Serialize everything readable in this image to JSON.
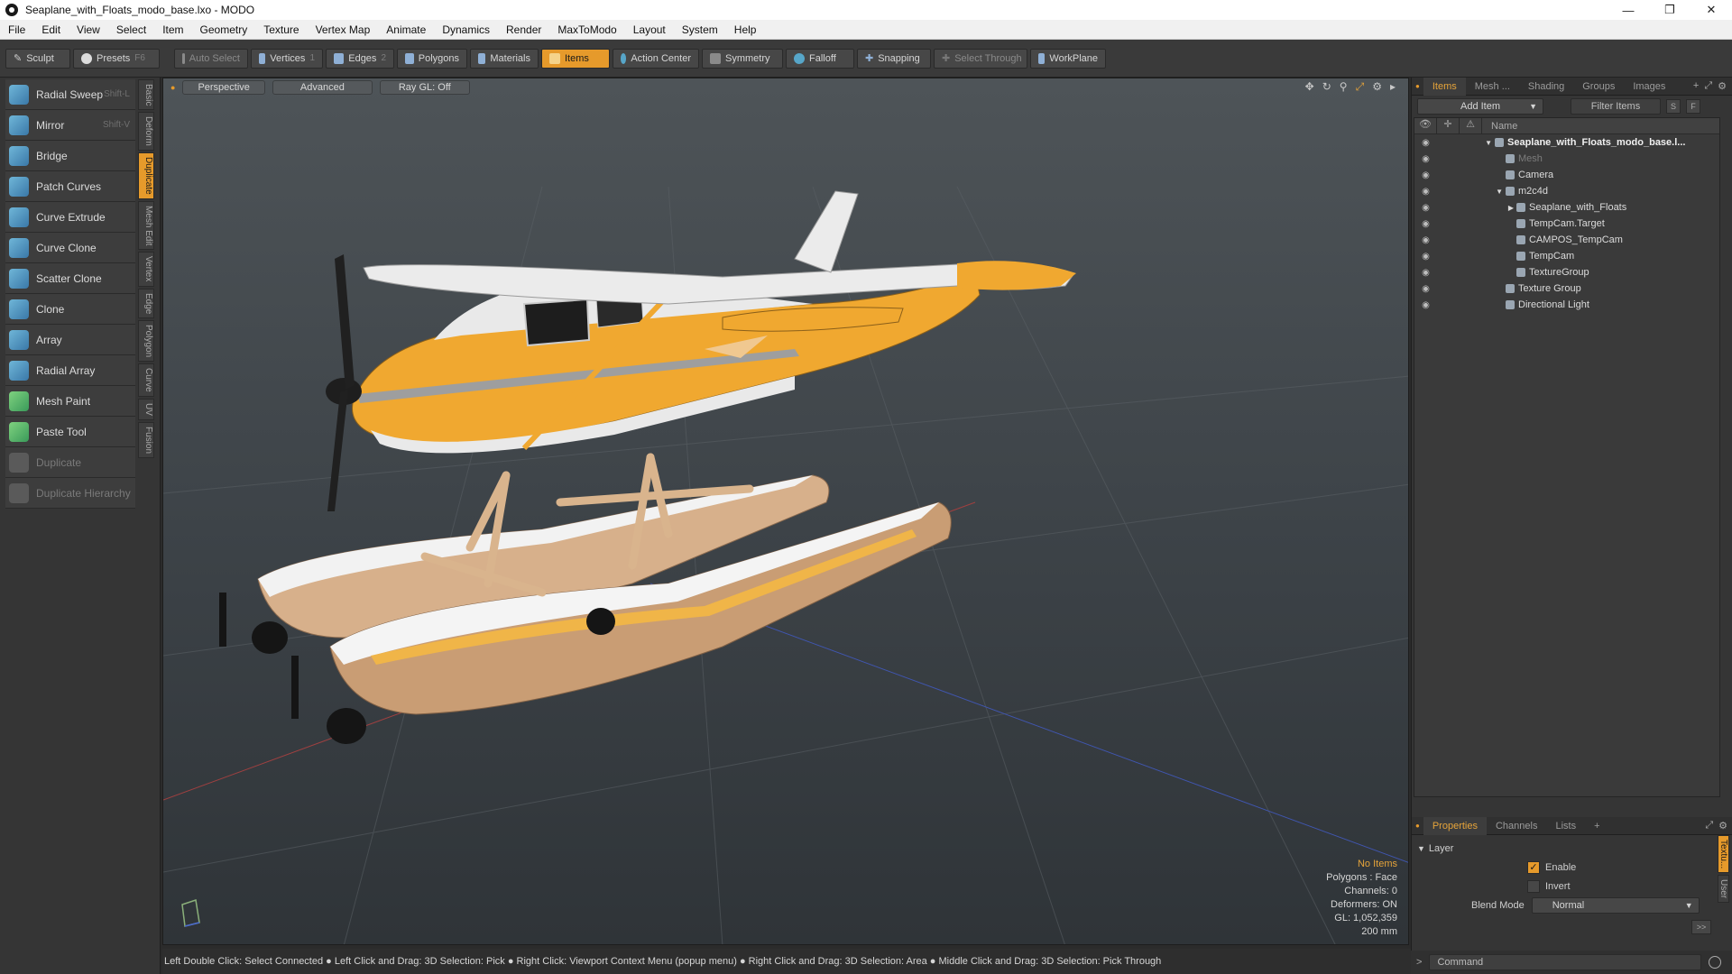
{
  "window": {
    "title": "Seaplane_with_Floats_modo_base.lxo - MODO",
    "controls": [
      "—",
      "❐",
      "✕"
    ]
  },
  "menu": [
    "File",
    "Edit",
    "View",
    "Select",
    "Item",
    "Geometry",
    "Texture",
    "Vertex Map",
    "Animate",
    "Dynamics",
    "Render",
    "MaxToModo",
    "Layout",
    "System",
    "Help"
  ],
  "toolbar": {
    "sculpt": "Sculpt",
    "presets": "Presets",
    "presets_key": "F6",
    "auto_select": "Auto Select",
    "vertices": "Vertices",
    "vertices_key": "1",
    "edges": "Edges",
    "edges_key": "2",
    "polygons": "Polygons",
    "materials": "Materials",
    "items": "Items",
    "action_center": "Action Center",
    "symmetry": "Symmetry",
    "falloff": "Falloff",
    "snapping": "Snapping",
    "select_through": "Select Through",
    "workplane": "WorkPlane"
  },
  "tools": [
    {
      "label": "Radial Sweep",
      "key": "Shift-L"
    },
    {
      "label": "Mirror",
      "key": "Shift-V"
    },
    {
      "label": "Bridge",
      "key": ""
    },
    {
      "label": "Patch Curves",
      "key": ""
    },
    {
      "label": "Curve Extrude",
      "key": ""
    },
    {
      "label": "Curve Clone",
      "key": ""
    },
    {
      "label": "Scatter Clone",
      "key": ""
    },
    {
      "label": "Clone",
      "key": ""
    },
    {
      "label": "Array",
      "key": ""
    },
    {
      "label": "Radial Array",
      "key": ""
    },
    {
      "label": "Mesh Paint",
      "key": ""
    },
    {
      "label": "Paste Tool",
      "key": ""
    },
    {
      "label": "Duplicate",
      "key": ""
    },
    {
      "label": "Duplicate Hierarchy",
      "key": ""
    }
  ],
  "vtabs": [
    "Basic",
    "Deform",
    "Duplicate",
    "Mesh Edit",
    "Vertex",
    "Edge",
    "Polygon",
    "Curve",
    "UV",
    "Fusion"
  ],
  "viewport": {
    "tabs": [
      "Perspective",
      "Advanced",
      "Ray GL: Off"
    ],
    "info": {
      "no_items": "No Items",
      "polygons": "Polygons : Face",
      "channels": "Channels: 0",
      "deformers": "Deformers: ON",
      "gl": "GL: 1,052,359",
      "scale": "200 mm"
    }
  },
  "right_panel": {
    "tabs": [
      "Items",
      "Mesh ...",
      "Shading",
      "Groups",
      "Images"
    ],
    "add_item": "Add Item",
    "filter_placeholder": "Filter Items",
    "btn_s": "S",
    "btn_f": "F",
    "col_name": "Name",
    "tree": [
      {
        "label": "Seaplane_with_Floats_modo_base.l...",
        "indent": 0,
        "expand": "▼",
        "bold": true
      },
      {
        "label": "Mesh",
        "indent": 1,
        "expand": "",
        "dim": true
      },
      {
        "label": "Camera",
        "indent": 1,
        "expand": ""
      },
      {
        "label": "m2c4d",
        "indent": 1,
        "expand": "▼"
      },
      {
        "label": "Seaplane_with_Floats",
        "indent": 2,
        "expand": "▶"
      },
      {
        "label": "TempCam.Target",
        "indent": 2,
        "expand": ""
      },
      {
        "label": "CAMPOS_TempCam",
        "indent": 2,
        "expand": ""
      },
      {
        "label": "TempCam",
        "indent": 2,
        "expand": ""
      },
      {
        "label": "TextureGroup",
        "indent": 2,
        "expand": ""
      },
      {
        "label": "Texture Group",
        "indent": 1,
        "expand": ""
      },
      {
        "label": "Directional Light",
        "indent": 1,
        "expand": ""
      }
    ],
    "props_tabs": [
      "Properties",
      "Channels",
      "Lists"
    ],
    "layer_label": "Layer",
    "enable_label": "Enable",
    "invert_label": "Invert",
    "blend_mode_label": "Blend Mode",
    "blend_mode_value": "Normal",
    "side_tabs": [
      "Textu...",
      "User"
    ],
    "command_placeholder": "Command"
  },
  "statusbar": "Left Double Click: Select Connected ● Left Click and Drag: 3D Selection: Pick ● Right Click: Viewport Context Menu (popup menu) ● Right Click and Drag: 3D Selection: Area ● Middle Click and Drag: 3D Selection: Pick Through",
  "colors": {
    "accent": "#e69a2b",
    "plane_body": "#f0a830",
    "plane_white": "#e9e9e9",
    "float_tan": "#c89b73"
  }
}
